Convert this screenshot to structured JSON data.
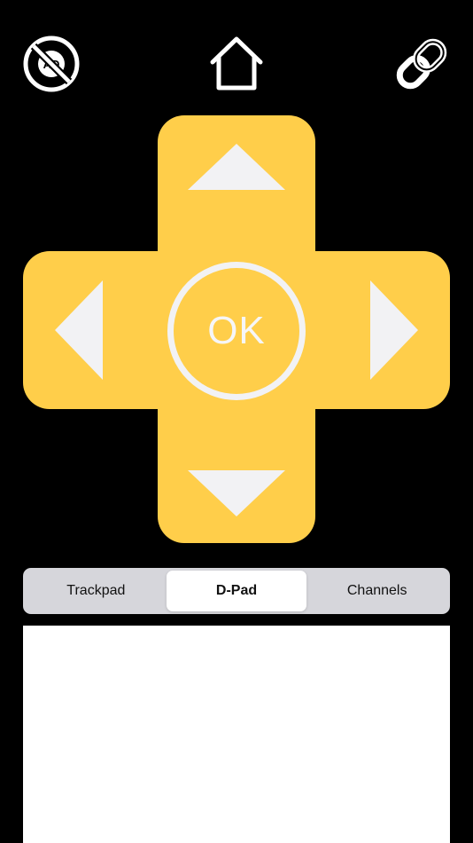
{
  "toolbar": {
    "no_ads_icon_text": "AD",
    "icons": {
      "left": "no-ads-icon",
      "center": "home-icon",
      "right": "link-icon"
    },
    "icon_color": "#FFFFFF"
  },
  "dpad": {
    "ok_label": "OK",
    "color": "#FFCE4A",
    "arrow_color": "#F2F2F4",
    "arrows": [
      "up",
      "left",
      "right",
      "down"
    ]
  },
  "tabs": {
    "items": [
      {
        "label": "Trackpad",
        "selected": false
      },
      {
        "label": "D-Pad",
        "selected": true
      },
      {
        "label": "Channels",
        "selected": false
      }
    ]
  }
}
